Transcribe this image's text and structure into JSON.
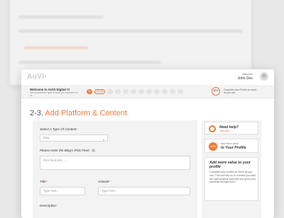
{
  "header": {
    "logo": "AuVi",
    "welcome_label": "Welcome",
    "user_name": "John Deo"
  },
  "stepbar": {
    "title": "Welcome to AUVI Digital !!!",
    "subtitle": "Tell us about the type of work you represent to us.",
    "steps": [
      "01",
      "02-03",
      "",
      "",
      "",
      "",
      "",
      "",
      "",
      "",
      "",
      "",
      "",
      ""
    ],
    "progress": "30%",
    "progress_text": "Complete your Profile as much as you can"
  },
  "page": {
    "step_number": "2-3.",
    "title": "Add Platform & Content"
  },
  "form": {
    "content_type_label": "Select A Type Of Content",
    "content_type_value": "Blog",
    "rss_label": "Please enter the Blog's RSS Feed",
    "rss_placeholder": "RSS feed URL......",
    "title_label": "Title",
    "title_placeholder": "Type here...",
    "artwork_label": "Artwork",
    "artwork_placeholder": "Type here...",
    "description_label": "Description"
  },
  "sidebar": {
    "help_title": "Need help?",
    "help_link": "click here",
    "pct_value": "10%",
    "pct_sub": "Add More value",
    "pct_title": "to Your Profile",
    "add_title": "Add more value to your profile",
    "add_body": "Complete your profile as much as you can. This will help us to connect you with the right projects and help you grow your business through AUVI."
  },
  "colors": {
    "accent": "#f07a3b"
  }
}
